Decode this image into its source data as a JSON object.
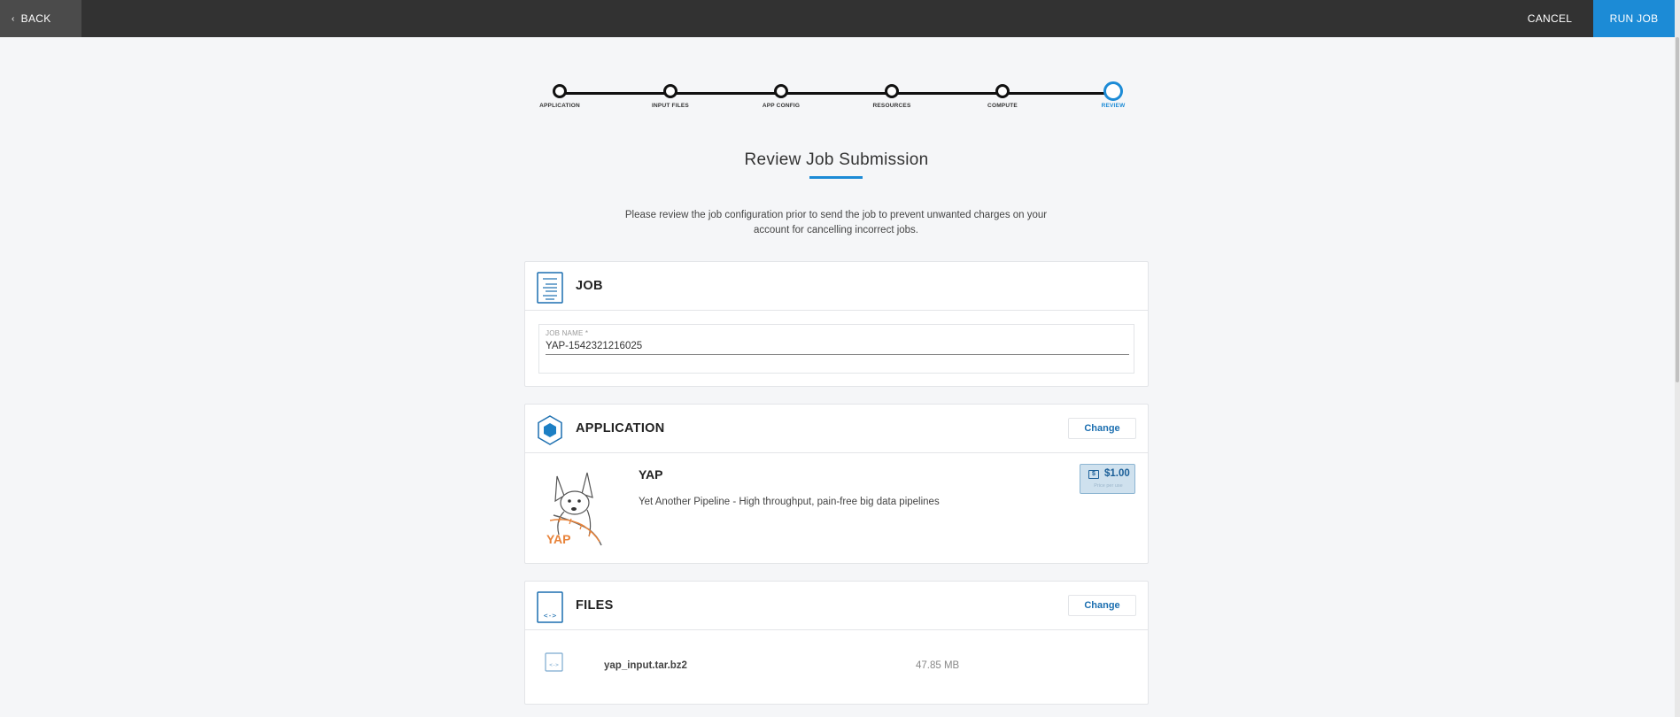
{
  "topbar": {
    "back_label": "BACK",
    "cancel_label": "CANCEL",
    "run_label": "RUN JOB",
    "accent_color": "#1c8bd6"
  },
  "stepper": {
    "steps": [
      "APPLICATION",
      "INPUT FILES",
      "APP CONFIG",
      "RESOURCES",
      "COMPUTE",
      "REVIEW"
    ],
    "active": "REVIEW"
  },
  "page": {
    "title": "Review Job Submission",
    "intro": "Please review the job configuration prior to send the job to prevent unwanted charges on your account for cancelling incorrect jobs."
  },
  "job": {
    "section_title": "JOB",
    "icon": "document-icon",
    "field_label": "JOB NAME *",
    "field_value": "YAP-1542321216025"
  },
  "application": {
    "section_title": "APPLICATION",
    "icon": "hexagon-icon",
    "change_label": "Change",
    "name": "YAP",
    "description": "Yet Another Pipeline - High throughput, pain-free big data pipelines",
    "logo_text": "YAP",
    "price": "$1.00",
    "price_sub": "Price per use"
  },
  "files": {
    "section_title": "FILES",
    "icon": "file-code-icon",
    "change_label": "Change",
    "items": [
      {
        "name": "yap_input.tar.bz2",
        "size": "47.85 MB"
      }
    ]
  }
}
